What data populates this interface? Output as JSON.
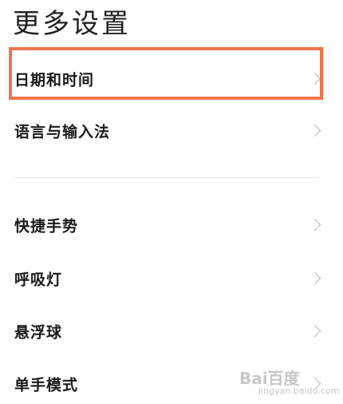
{
  "page": {
    "title": "更多设置"
  },
  "settings": {
    "items": [
      {
        "label": "日期和时间",
        "icon": "chevron-right-icon",
        "highlighted": true
      },
      {
        "label": "语言与输入法",
        "icon": "chevron-right-icon",
        "highlighted": false
      },
      {
        "label": "快捷手势",
        "icon": "chevron-right-icon",
        "highlighted": false
      },
      {
        "label": "呼吸灯",
        "icon": "chevron-right-icon",
        "highlighted": false
      },
      {
        "label": "悬浮球",
        "icon": "chevron-right-icon",
        "highlighted": false
      },
      {
        "label": "单手模式",
        "icon": "chevron-right-icon",
        "highlighted": false
      }
    ]
  },
  "annotation": {
    "highlight_color": "#ed7648"
  },
  "watermark": {
    "logo": "Bai百度",
    "sub": "jingyan.baidu.com"
  }
}
